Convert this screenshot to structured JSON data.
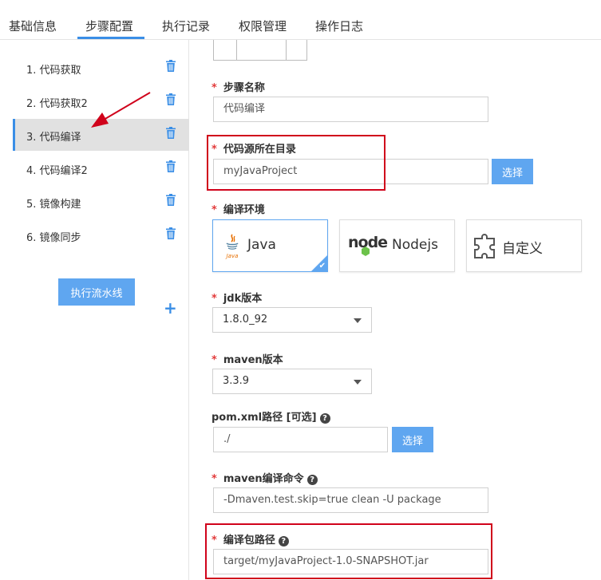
{
  "tabs": [
    {
      "label": "基础信息"
    },
    {
      "label": "步骤配置"
    },
    {
      "label": "执行记录"
    },
    {
      "label": "权限管理"
    },
    {
      "label": "操作日志"
    }
  ],
  "active_tab": "步骤配置",
  "steps": [
    {
      "label": "1. 代码获取"
    },
    {
      "label": "2. 代码获取2"
    },
    {
      "label": "3. 代码编译"
    },
    {
      "label": "4. 代码编译2"
    },
    {
      "label": "5. 镜像构建"
    },
    {
      "label": "6. 镜像同步"
    }
  ],
  "active_step": "3. 代码编译",
  "run_pipeline_label": "执行流水线",
  "add_step_symbol": "+",
  "form": {
    "step_name": {
      "label": "步骤名称",
      "value": "代码编译"
    },
    "source_dir": {
      "label": "代码源所在目录",
      "value": "myJavaProject",
      "button": "选择"
    },
    "env": {
      "label": "编译环境",
      "options": [
        {
          "label": "Java",
          "selected": true
        },
        {
          "label": "Nodejs",
          "logo_text": "node",
          "selected": false
        },
        {
          "label": "自定义",
          "selected": false
        }
      ],
      "java_logo_text": "Java"
    },
    "jdk": {
      "label": "jdk版本",
      "value": "1.8.0_92"
    },
    "maven": {
      "label": "maven版本",
      "value": "3.3.9"
    },
    "pom": {
      "label": "pom.xml路径 [可选]",
      "value": "./",
      "button": "选择"
    },
    "maven_cmd": {
      "label": "maven编译命令",
      "value": "-Dmaven.test.skip=true clean -U package"
    },
    "artifact": {
      "label": "编译包路径",
      "value": "target/myJavaProject-1.0-SNAPSHOT.jar"
    },
    "required_mark": "*",
    "help_mark": "?"
  },
  "colors": {
    "accent": "#3a8ee6",
    "button": "#5fa6f0",
    "required": "#e23b3b",
    "highlight": "#d0021b",
    "active_step_bg": "#e1e1e1"
  }
}
